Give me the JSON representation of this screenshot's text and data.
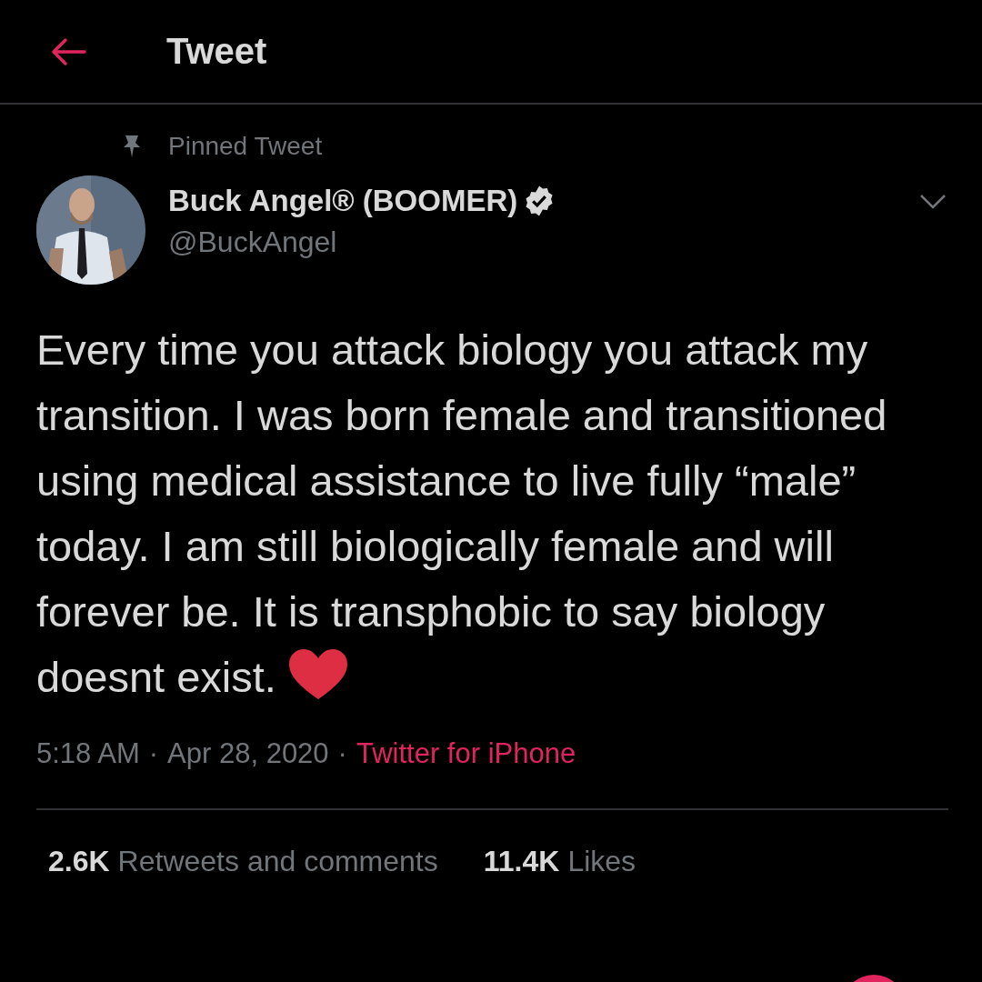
{
  "header": {
    "title": "Tweet"
  },
  "pinned_label": "Pinned Tweet",
  "author": {
    "name": "Buck Angel® (BOOMER)",
    "verified": true,
    "handle": "@BuckAngel"
  },
  "tweet_text": "Every time you attack biology you attack my transition. I was born female and transitioned using medical assistance to live fully “male” today. I am still biologically female and will forever be. It is transphobic to say biology doesnt exist.",
  "meta": {
    "time": "5:18 AM",
    "separator_1": "·",
    "date": "Apr 28, 2020",
    "separator_2": "·",
    "source": "Twitter for iPhone"
  },
  "stats": [
    {
      "count": "2.6K",
      "label": "Retweets and comments"
    },
    {
      "count": "11.4K",
      "label": "Likes"
    }
  ]
}
